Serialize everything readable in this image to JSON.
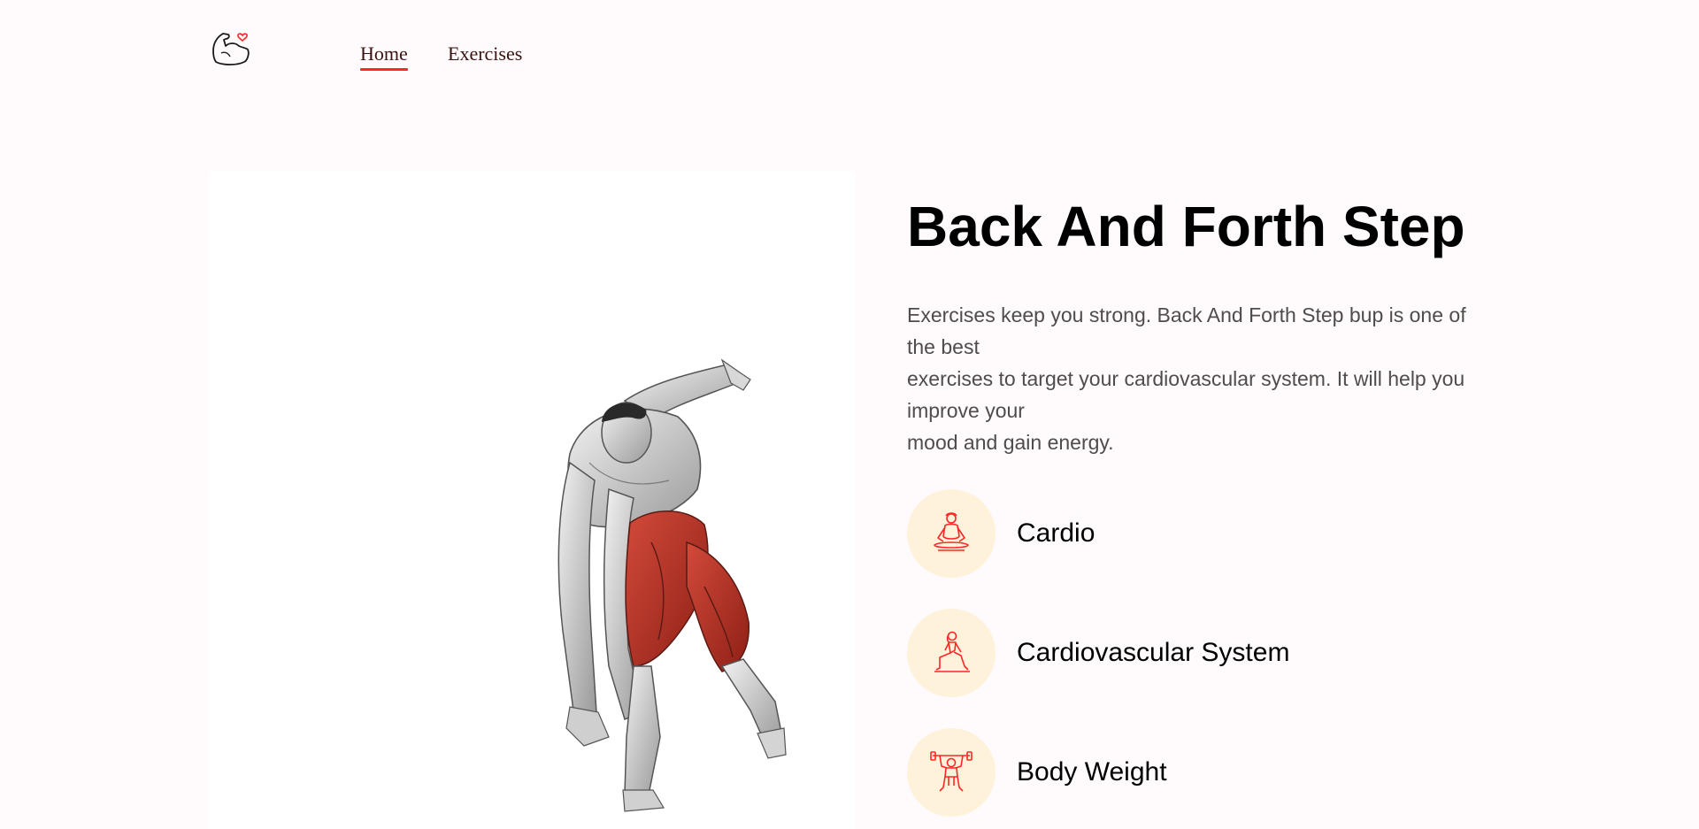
{
  "navbar": {
    "logo": "gym-logo",
    "links": [
      {
        "label": "Home",
        "active": true
      },
      {
        "label": "Exercises",
        "active": false
      }
    ]
  },
  "exercise": {
    "image": "exercise-illustration",
    "title": "Back And Forth Step",
    "description_lines": [
      "Exercises keep you strong. Back And Forth Step bup is one of the best",
      "exercises to target your cardiovascular system. It will help you improve your",
      "mood and gain energy."
    ],
    "tags": [
      {
        "icon": "meditation-icon",
        "label": "Cardio"
      },
      {
        "icon": "lunge-stretch-icon",
        "label": "Cardiovascular System"
      },
      {
        "icon": "weightlifter-icon",
        "label": "Body Weight"
      }
    ]
  },
  "colors": {
    "accent": "#ff2625",
    "tag_background": "#fff2db",
    "page_background": "#fffafb"
  }
}
